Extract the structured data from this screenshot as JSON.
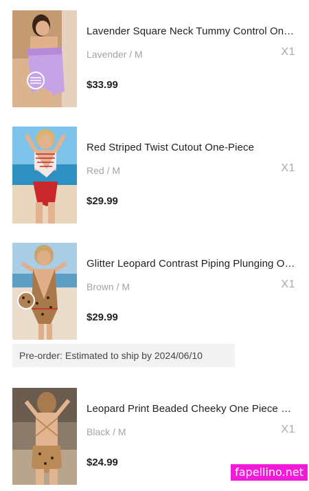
{
  "cart_items": [
    {
      "title": "Lavender Square Neck Tummy Control One-Piece Swimsuit",
      "variant": "Lavender / M",
      "quantity": "X1",
      "price": "$33.99",
      "image_icon": "swimsuit-lavender-thumbnail",
      "color": "#c9a3e6"
    },
    {
      "title": "Red Striped Twist Cutout One-Piece",
      "variant": "Red / M",
      "quantity": "X1",
      "price": "$29.99",
      "image_icon": "swimsuit-red-striped-thumbnail",
      "color": "#c8282c"
    },
    {
      "title": "Glitter Leopard Contrast Piping Plunging One-Piece Swimsuit",
      "variant": "Brown / M",
      "quantity": "X1",
      "price": "$29.99",
      "image_icon": "swimsuit-leopard-thumbnail",
      "color": "#a9794a"
    },
    {
      "title": "Leopard Print Beaded Cheeky One Piece Swimsuit",
      "variant": "Black / M",
      "quantity": "X1",
      "price": "$24.99",
      "image_icon": "swimsuit-leopard-back-thumbnail",
      "color": "#b98a57"
    }
  ],
  "preorder_note": "Pre-order: Estimated to ship by 2024/06/10",
  "watermark": "fapellino.net"
}
